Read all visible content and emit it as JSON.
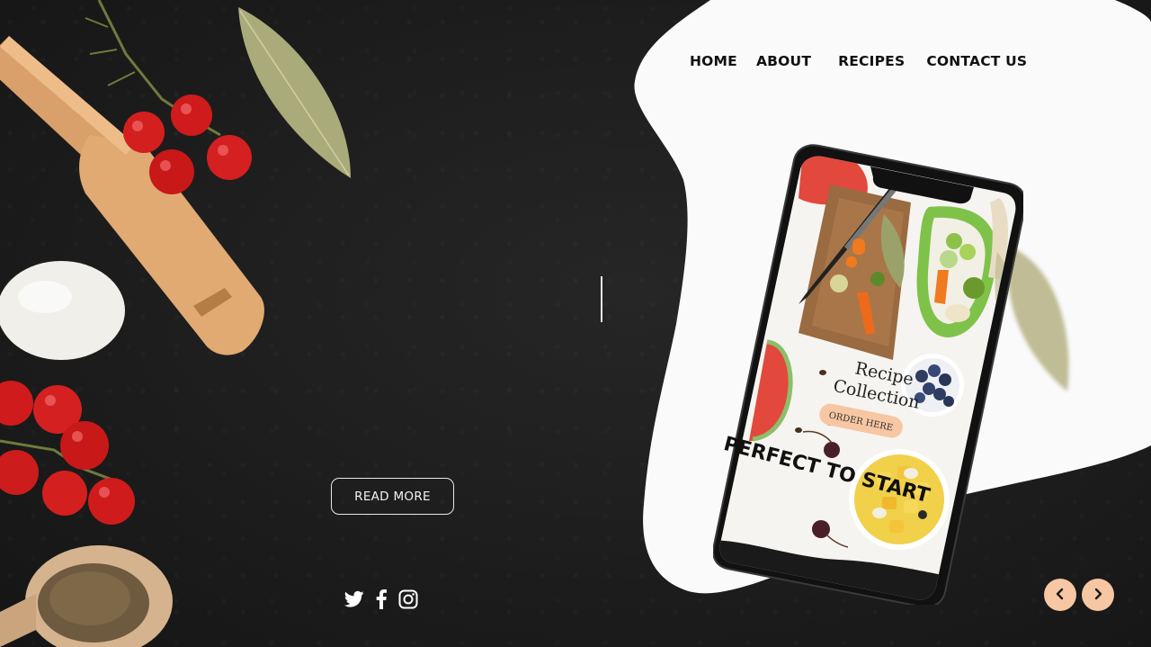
{
  "nav": {
    "home": "HOME",
    "about": "ABOUT",
    "recipes": "RECIPES",
    "contact": "CONTACT US"
  },
  "hero": {
    "read_more_label": "READ MORE"
  },
  "phone_screen": {
    "heading_line1": "Recipe",
    "heading_line2": "Collection",
    "order_label": "ORDER HERE",
    "tagline": "PERFECT TO START"
  },
  "social": {
    "icons": [
      "twitter-icon",
      "facebook-icon",
      "instagram-icon"
    ]
  },
  "slider": {
    "icons": [
      "chevron-left-icon",
      "chevron-right-icon"
    ]
  },
  "colors": {
    "background": "#1c1c1c",
    "accent_peach": "#f6c7a2",
    "nav_text": "#111111",
    "blob": "#fafafa"
  }
}
